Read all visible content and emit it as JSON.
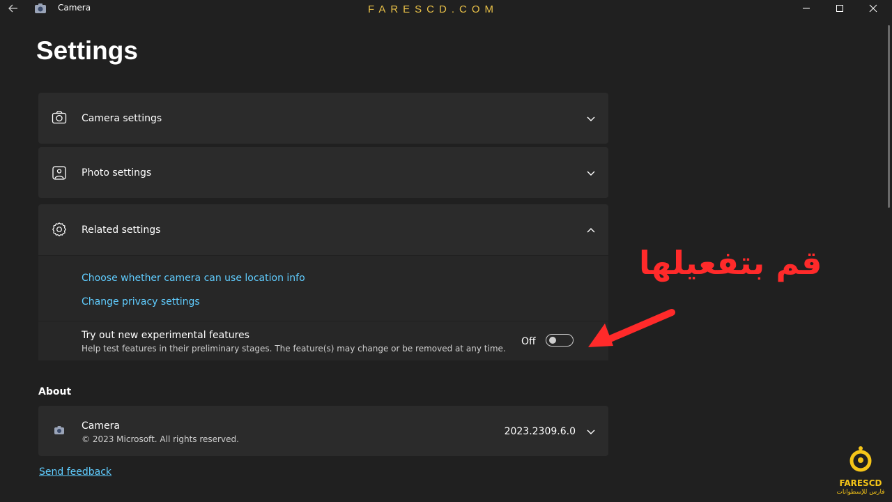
{
  "titlebar": {
    "app_title": "Camera",
    "watermark": "FARESCD.COM",
    "icons": [
      "back-arrow-icon",
      "camera-app-icon",
      "minimize-icon",
      "maximize-icon",
      "close-icon"
    ]
  },
  "page": {
    "title": "Settings"
  },
  "sections": {
    "camera": {
      "label": "Camera settings",
      "icon": "camera-icon",
      "expanded": false
    },
    "photo": {
      "label": "Photo settings",
      "icon": "photo-icon",
      "expanded": false
    },
    "related": {
      "label": "Related settings",
      "icon": "gear-icon",
      "expanded": true,
      "links": [
        "Choose whether camera can use location info",
        "Change privacy settings"
      ],
      "experimental": {
        "title": "Try out new experimental features",
        "description": "Help test features in their preliminary stages. The feature(s) may change or be removed at any time.",
        "state_label": "Off",
        "enabled": false
      }
    }
  },
  "about": {
    "heading": "About",
    "app_name": "Camera",
    "copyright": "© 2023 Microsoft. All rights reserved.",
    "version": "2023.2309.6.0"
  },
  "feedback_link": "Send feedback",
  "annotation": {
    "text": "قم بتفعيلها",
    "color": "#ff2a2a"
  },
  "logo": {
    "name": "FARESCD",
    "subtitle": "فارس للإسطوانات",
    "color": "#f5c518"
  },
  "colors": {
    "background": "#202020",
    "card": "#2b2b2b",
    "link": "#60cdff"
  }
}
